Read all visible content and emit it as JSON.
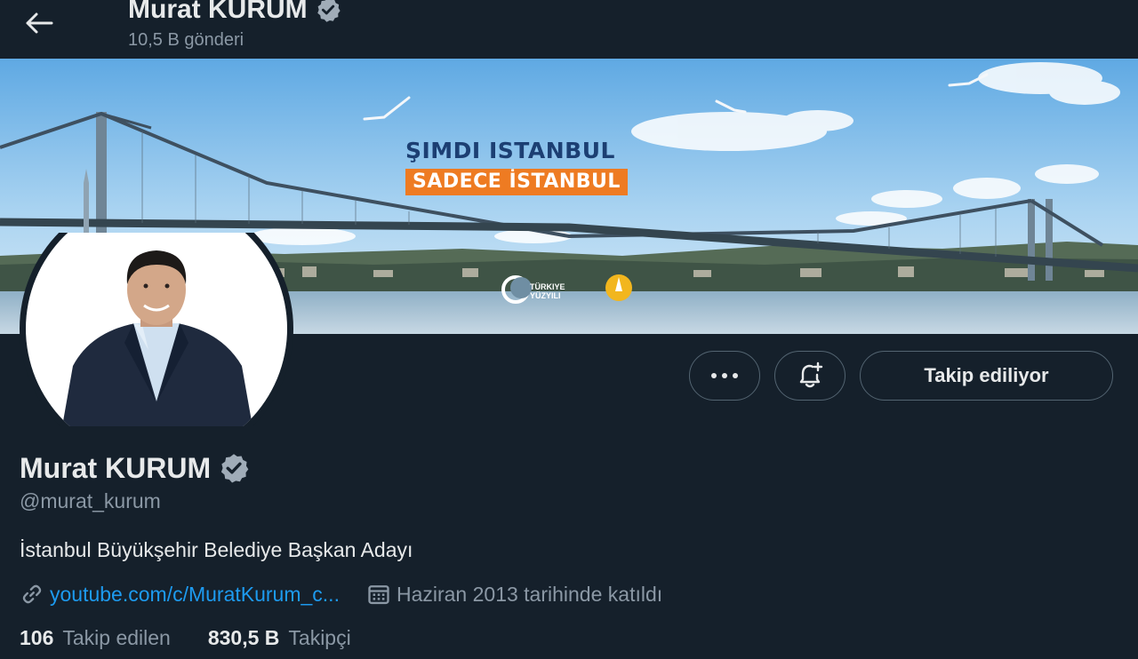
{
  "header": {
    "back_icon": "arrow-left-icon",
    "name": "Murat KURUM",
    "posts": "10,5 B gönderi",
    "verified_icon": "verified-badge-icon"
  },
  "banner": {
    "line1": "ŞIMDI ISTANBUL",
    "line2": "SADECE İSTANBUL",
    "brand": "TÜRKIYE YÜZYILI",
    "colors": {
      "sky": "#8fc3ea",
      "accent_orange": "#ee7b22",
      "text_blue": "#1c3f73"
    }
  },
  "actions": {
    "more_label": "•••",
    "more_icon": "more-dots-icon",
    "notify_icon": "bell-plus-icon",
    "following_label": "Takip ediliyor"
  },
  "profile": {
    "display_name": "Murat KURUM",
    "handle": "@murat_kurum",
    "bio": "İstanbul Büyükşehir Belediye Başkan Adayı",
    "link_icon": "link-icon",
    "link_text": "youtube.com/c/MuratKurum_c...",
    "calendar_icon": "calendar-icon",
    "joined": "Haziran 2013 tarihinde katıldı",
    "following_count": "106",
    "following_label": "Takip edilen",
    "followers_count": "830,5 B",
    "followers_label": "Takipçi"
  },
  "theme": {
    "background": "#15202b",
    "text": "#e7e9ea",
    "muted": "#8b98a5",
    "link": "#1d9bf0",
    "border": "#536471"
  }
}
